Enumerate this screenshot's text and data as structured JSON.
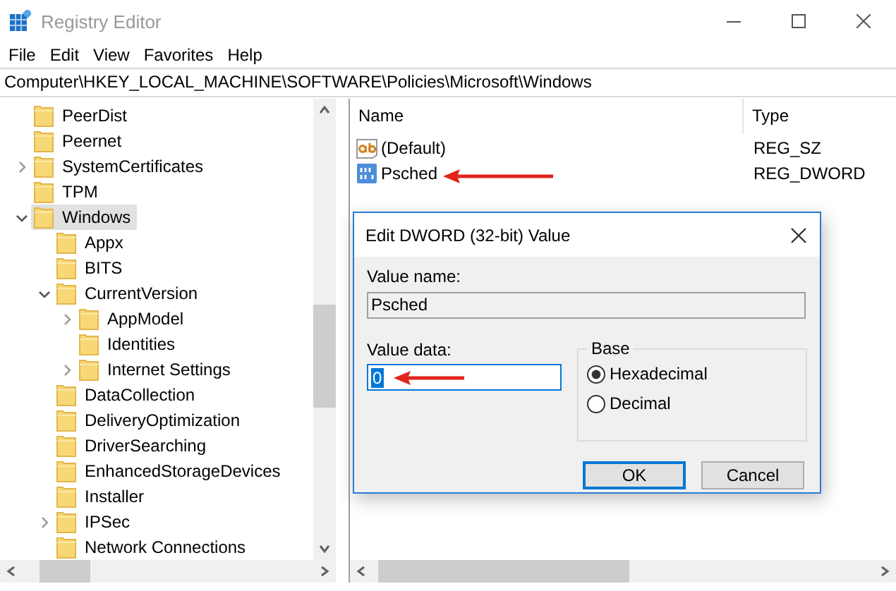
{
  "window": {
    "title": "Registry Editor"
  },
  "menu": [
    "File",
    "Edit",
    "View",
    "Favorites",
    "Help"
  ],
  "address": "Computer\\HKEY_LOCAL_MACHINE\\SOFTWARE\\Policies\\Microsoft\\Windows",
  "tree": [
    {
      "label": "PeerDist",
      "expandable": false,
      "selected": false
    },
    {
      "label": "Peernet",
      "expandable": false,
      "selected": false
    },
    {
      "label": "SystemCertificates",
      "expandable": true,
      "expanded": false,
      "selected": false
    },
    {
      "label": "TPM",
      "expandable": false,
      "selected": false
    },
    {
      "label": "Windows",
      "expandable": true,
      "expanded": true,
      "selected": true,
      "children": [
        {
          "label": "Appx",
          "expandable": false,
          "selected": false
        },
        {
          "label": "BITS",
          "expandable": false,
          "selected": false
        },
        {
          "label": "CurrentVersion",
          "expandable": true,
          "expanded": true,
          "selected": false,
          "children": [
            {
              "label": "AppModel",
              "expandable": true,
              "expanded": false,
              "selected": false
            },
            {
              "label": "Identities",
              "expandable": false,
              "selected": false
            },
            {
              "label": "Internet Settings",
              "expandable": true,
              "expanded": false,
              "selected": false
            }
          ]
        },
        {
          "label": "DataCollection",
          "expandable": false,
          "selected": false
        },
        {
          "label": "DeliveryOptimization",
          "expandable": false,
          "selected": false
        },
        {
          "label": "DriverSearching",
          "expandable": false,
          "selected": false
        },
        {
          "label": "EnhancedStorageDevices",
          "expandable": false,
          "selected": false
        },
        {
          "label": "Installer",
          "expandable": false,
          "selected": false
        },
        {
          "label": "IPSec",
          "expandable": true,
          "expanded": false,
          "selected": false
        },
        {
          "label": "Network Connections",
          "expandable": false,
          "selected": false
        }
      ]
    }
  ],
  "list": {
    "columns": [
      "Name",
      "Type"
    ],
    "rows": [
      {
        "kind": "string",
        "name": "(Default)",
        "type": "REG_SZ"
      },
      {
        "kind": "dword",
        "name": "Psched",
        "type": "REG_DWORD"
      }
    ]
  },
  "dialog": {
    "title": "Edit DWORD (32-bit) Value",
    "value_name_label": "Value name:",
    "value_name": "Psched",
    "value_data_label": "Value data:",
    "value_data": "0",
    "value_data_highlighted": true,
    "base_label": "Base",
    "bases": [
      {
        "label": "Hexadecimal",
        "selected": true
      },
      {
        "label": "Decimal",
        "selected": false
      }
    ],
    "buttons": [
      {
        "label": "OK",
        "default": true
      },
      {
        "label": "Cancel",
        "default": false
      }
    ]
  }
}
